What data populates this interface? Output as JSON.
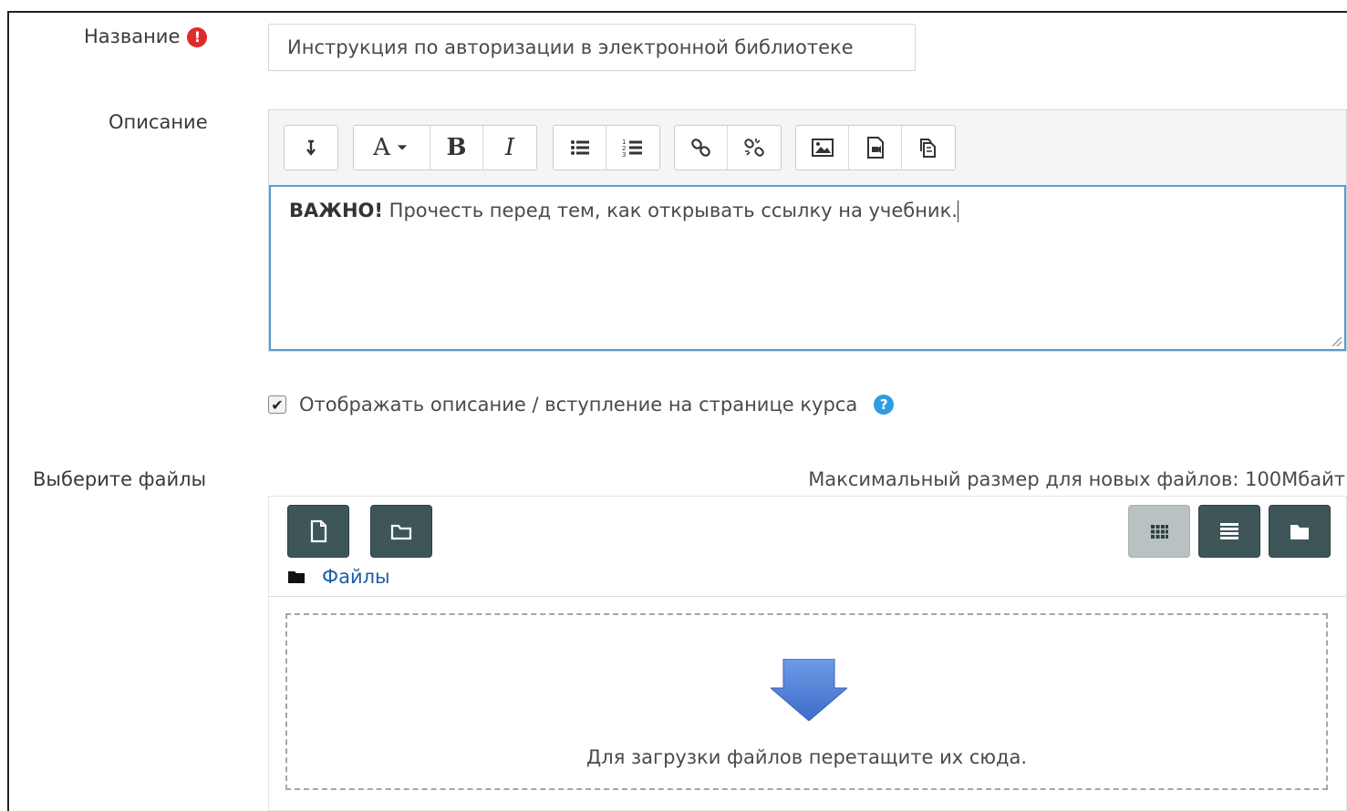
{
  "form": {
    "name_label": "Название",
    "name_value": "Инструкция по авторизации в электронной библиотеке",
    "description_label": "Описание",
    "description_bold": "ВАЖНО!",
    "description_text": " Прочесть перед тем, как открывать ссылку на учебник.",
    "show_description_label": "Отображать описание / вступление на странице курса",
    "show_description_checked": true,
    "files_label": "Выберите файлы",
    "max_size_text": "Максимальный размер для новых файлов: 100Мбайт"
  },
  "toolbar": {
    "format_label": "A",
    "bold_label": "B",
    "italic_label": "I"
  },
  "filemanager": {
    "path_label": "Файлы",
    "drop_text": "Для загрузки файлов перетащите их сюда.",
    "active_view": "icons"
  },
  "colors": {
    "required": "#e12b2b",
    "help": "#2f9de0",
    "focus_border": "#5b9bd5",
    "fm_button": "#3f5659",
    "link": "#1d5fa8",
    "drop_arrow": "#4f7fd8"
  }
}
